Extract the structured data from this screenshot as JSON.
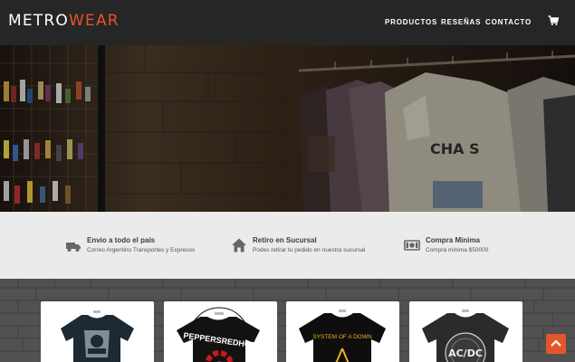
{
  "brand": {
    "main": "METRO",
    "accent": "WEAR"
  },
  "nav": {
    "items": [
      {
        "label": "PRODUCTOS"
      },
      {
        "label": "RESEÑAS"
      },
      {
        "label": "CONTACTO"
      }
    ],
    "cart_icon": "shopping-cart-icon"
  },
  "features": [
    {
      "icon": "truck-icon",
      "title": "Envio a todo el pais",
      "desc": "Correo Argentino Transportes y Expresos"
    },
    {
      "icon": "home-icon",
      "title": "Retiro en Sucursal",
      "desc": "Podes retirar tu pedido en nuestra sucursal"
    },
    {
      "icon": "money-icon",
      "title": "Compra Minima",
      "desc": "Compra minima $50000"
    }
  ],
  "products": [
    {
      "name": "guns-n-roses-tshirt"
    },
    {
      "name": "red-hot-chili-peppers-tshirt",
      "print": "PEPPERSREDHOT"
    },
    {
      "name": "system-of-a-down-tshirt",
      "print": "SYSTEM OF A DOWN"
    },
    {
      "name": "acdc-tshirt",
      "print": "AC/DC"
    }
  ],
  "colors": {
    "accent": "#e8532a",
    "navbar": "#262626",
    "features_bg": "#ebebeb"
  },
  "scroll_top_icon": "chevron-up-icon"
}
